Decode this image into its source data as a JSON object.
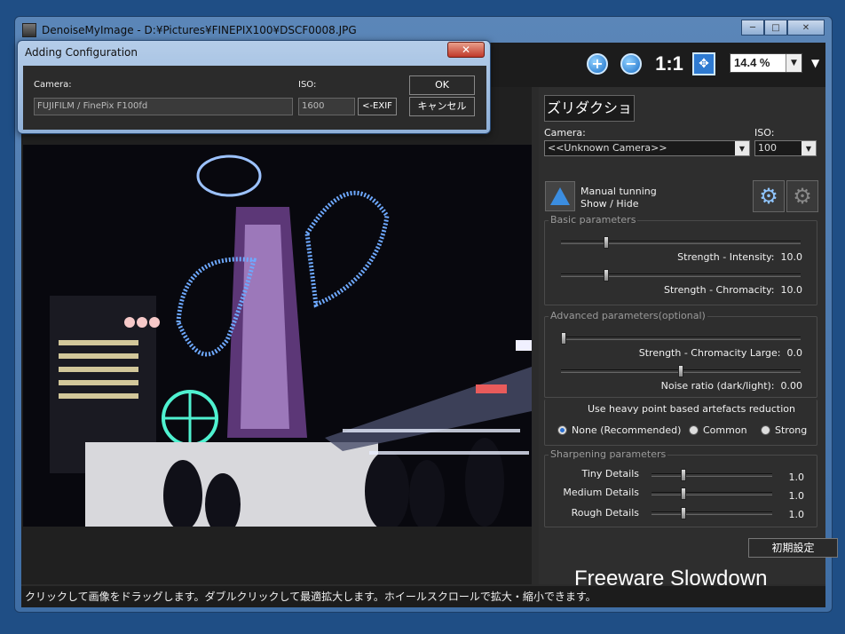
{
  "window": {
    "title": "DenoiseMyImage - D:¥Pictures¥FINEPIX100¥DSCF0008.JPG",
    "minimize": "─",
    "maximize": "□",
    "close": "✕"
  },
  "toolbar": {
    "zoom_in_glyph": "+",
    "zoom_out_glyph": "−",
    "actual_size_label": "1:1",
    "fit_glyph": "✥",
    "zoom_value": "14.4 %",
    "zoom_arrow": "▼",
    "menu_arrow": "▼"
  },
  "dialog": {
    "title": "Adding Configuration",
    "close_glyph": "✕",
    "camera_label": "Camera:",
    "camera_value": "FUJIFILM / FinePix F100fd",
    "iso_label": "ISO:",
    "iso_value": "1600",
    "exif_button": "<-EXIF",
    "ok_button": "OK",
    "cancel_button": "キャンセル"
  },
  "panel": {
    "title": "ズリダクション",
    "camera_label": "Camera:",
    "camera_value": "<<Unknown Camera>>",
    "iso_label": "ISO:",
    "iso_value": "100",
    "manual_tuning_line1": "Manual tunning",
    "manual_tuning_line2": "Show / Hide",
    "basic": {
      "title": "Basic parameters",
      "intensity_label": "Strength - Intensity:",
      "intensity_value": "10.0",
      "chromacity_label": "Strength - Chromacity:",
      "chromacity_value": "10.0",
      "intensity_level": 0.18,
      "chromacity_level": 0.18
    },
    "advanced": {
      "title": "Advanced parameters(optional)",
      "chroma_large_label": "Strength - Chromacity Large:",
      "chroma_large_value": "0.0",
      "noise_ratio_label": "Noise ratio (dark/light):",
      "noise_ratio_value": "0.00",
      "chroma_large_level": 0.0,
      "noise_ratio_level": 0.5
    },
    "artefacts": {
      "title": "Use heavy point based artefacts reduction",
      "options": [
        "None (Recommended)",
        "Common",
        "Strong"
      ],
      "selected": "None (Recommended)"
    },
    "sharpening": {
      "title": "Sharpening parameters",
      "tiny_label": "Tiny Details",
      "tiny_value": "1.0",
      "medium_label": "Medium Details",
      "medium_value": "1.0",
      "rough_label": "Rough Details",
      "rough_value": "1.0",
      "tiny_level": 0.25,
      "medium_level": 0.25,
      "rough_level": 0.25
    },
    "reset_button": "初期設定",
    "freeware_text": "Freeware Slowdown"
  },
  "status_bar": "クリックして画像をドラッグします。ダブルクリックして最適拡大します。ホイールスクロールで拡大・縮小できます。"
}
